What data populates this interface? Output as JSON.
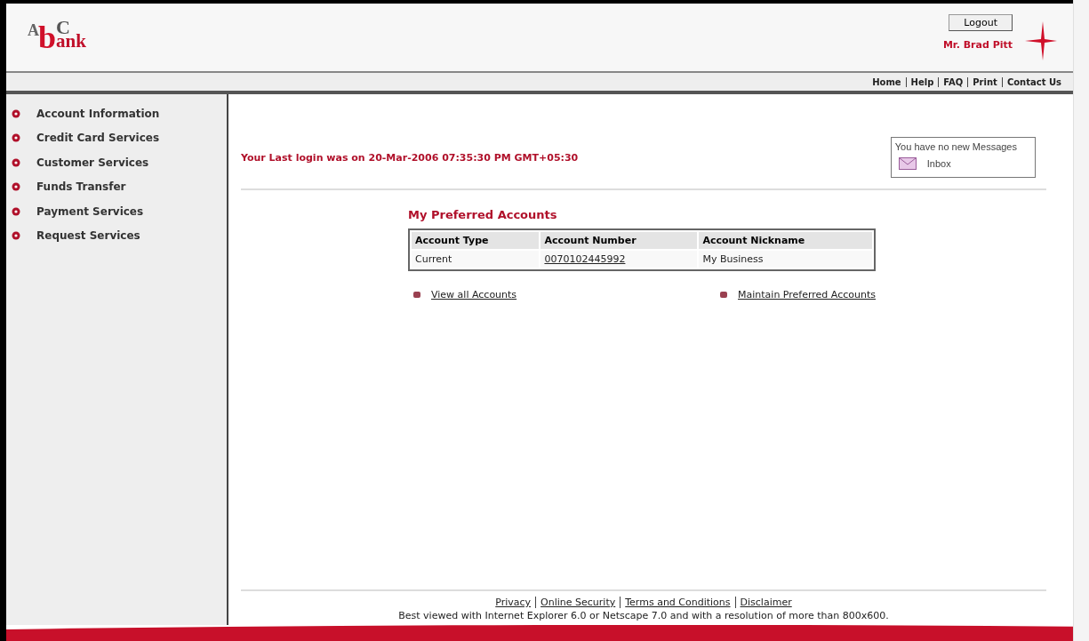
{
  "logo": {
    "letters": [
      "A",
      "b",
      "C",
      "ank"
    ]
  },
  "header": {
    "logout": "Logout",
    "user": "Mr. Brad Pitt"
  },
  "top_links": [
    "Home",
    "Help",
    "FAQ",
    "Print",
    "Contact Us"
  ],
  "sidebar": {
    "items": [
      {
        "label": "Account Information"
      },
      {
        "label": "Credit Card Services"
      },
      {
        "label": "Customer Services"
      },
      {
        "label": "Funds Transfer"
      },
      {
        "label": "Payment Services"
      },
      {
        "label": "Request Services"
      }
    ]
  },
  "last_login": "Your Last login was on 20-Mar-2006 07:35:30 PM GMT+05:30",
  "messages": {
    "text": "You have no new Messages",
    "inbox": "Inbox"
  },
  "accounts": {
    "title": "My Preferred Accounts",
    "columns": [
      "Account Type",
      "Account Number",
      "Account Nickname"
    ],
    "rows": [
      {
        "type": "Current",
        "number": "0070102445992",
        "nickname": "My Business"
      }
    ]
  },
  "links": [
    "View all Accounts",
    "Maintain Preferred Accounts"
  ],
  "footer": {
    "links": [
      "Privacy",
      "Online Security",
      "Terms and Conditions",
      "Disclaimer"
    ],
    "note": "Best viewed with Internet Explorer 6.0 or Netscape 7.0 and with a resolution of more than 800x600."
  }
}
